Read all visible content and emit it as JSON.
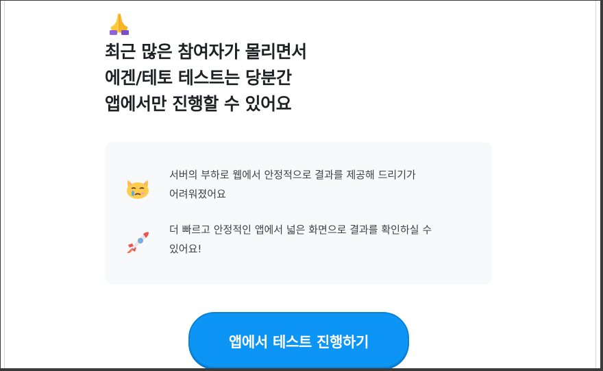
{
  "headline": {
    "line1": "최근 많은 참여자가 몰리면서",
    "line2": "에겐/테토 테스트는 당분간",
    "line3": "앱에서만 진행할 수 있어요"
  },
  "icons": {
    "top": "folded-hands-icon",
    "row1": "crying-cat-icon",
    "row2": "rocket-icon"
  },
  "info": {
    "row1": {
      "line1": "서버의 부하로 웹에서 안정적으로 결과를 제공해 드리기가",
      "line2": "어려워졌어요"
    },
    "row2": {
      "line1": "더 빠르고 안정적인 앱에서 넓은 화면으로 결과를 확인하실 수",
      "line2": "있어요!"
    }
  },
  "cta": {
    "label": "앱에서 테스트 진행하기"
  },
  "colors": {
    "accent": "#0c95f4",
    "card_bg": "#f8f9fa",
    "headline": "#1f2124",
    "body_text": "#3d4148"
  }
}
